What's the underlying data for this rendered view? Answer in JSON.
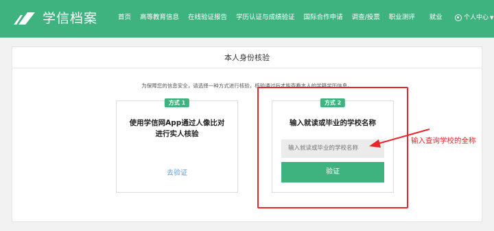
{
  "header": {
    "logo_text": "学信档案",
    "nav": [
      "首页",
      "高等教育信息",
      "在线验证报告",
      "学历认证与成绩验证",
      "国际合作申请",
      "调查/投票",
      "职业测评",
      "就业"
    ],
    "user_label": "个人中心",
    "bg_color": "#3fb37f"
  },
  "card": {
    "title": "本人身份核验",
    "notice": "为保障您的信息安全，请选择一种方式进行核验，核验通过后才能查看本人的学籍学历信息。"
  },
  "method1": {
    "badge": "方式 1",
    "title_line1": "使用学信网App通过人像比对",
    "title_line2": "进行实人核验",
    "link": "去验证"
  },
  "method2": {
    "badge": "方式 2",
    "title": "输入就读或毕业的学校名称",
    "input_placeholder": "输入就读或毕业的学校名称",
    "button": "验证"
  },
  "annotation": {
    "text": "输入查询学校的全称",
    "color": "#e8262b"
  }
}
